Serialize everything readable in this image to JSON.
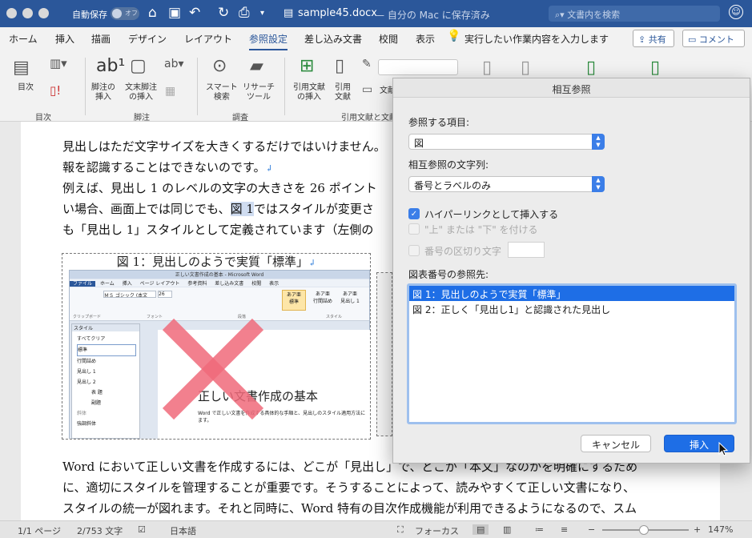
{
  "titlebar": {
    "autosave": "自動保存",
    "toggle": "オフ",
    "filename": "sample45.docx",
    "savestate": "— 自分の Mac に保存済み",
    "search": "文書内を検索"
  },
  "tabs": [
    "ホーム",
    "挿入",
    "描画",
    "デザイン",
    "レイアウト",
    "参照設定",
    "差し込み文書",
    "校閲",
    "表示"
  ],
  "tellme": "実行したい作業内容を入力します",
  "share": "共有",
  "comment": "コメント",
  "ribbon": {
    "toc": "目次",
    "footnote_insert": "脚注の\n挿入",
    "endnote_insert": "文末脚注\nの挿入",
    "smart": "スマート\n検索",
    "research": "リサーチ\nツール",
    "citation_insert": "引用文献\nの挿入",
    "citation": "引用\n文献",
    "citation_style": "文献",
    "groups": [
      "目次",
      "脚注",
      "調査",
      "引用文献と文献"
    ]
  },
  "doc": {
    "lines": [
      "見出しはただ文字サイズを大きくするだけではいけません。",
      "報を認識することはできないのです。",
      "例えば、見出し 1 のレベルの文字の大きさを 26 ポイント",
      "い場合、画面上では同じでも、",
      "図 1",
      "ではスタイルが変更さ",
      "も「見出し 1」スタイルとして定義されています（左側の"
    ],
    "fig_caption": "図 1：見出しのようで実質「標準」",
    "fig_title": "正しい文書作成の基本 - Microsoft Word",
    "fig_tabs": [
      "ファイル",
      "ホーム",
      "挿入",
      "ページ レイアウト",
      "参考資料",
      "差し込み文書",
      "校閲",
      "表示"
    ],
    "fig_font": "ＭＳ ゴシック (本文",
    "fig_size": "26",
    "fig_styles": [
      "あア亜\n標準",
      "あア亜\n行間詰め",
      "あア亜\n見出し 1"
    ],
    "fig_group_labels": [
      "クリップボード",
      "フォント",
      "段落",
      "スタイル"
    ],
    "fig_pane_title": "スタイル",
    "fig_pane_items": [
      "すべてクリア",
      "標準",
      "行間詰め",
      "見出し 1",
      "見出し 2",
      "表 題",
      "副題",
      "斜体",
      "強調斜体"
    ],
    "fig_heading": "正しい文書作成の基本",
    "fig_body": "Word で正しい文書を作成する具体的な手順と、見出しのスタイル適用方法に ます。",
    "after": [
      "Word において正しい文書を作成するには、どこが「見出し」で、どこが「本文」なのかを明確にするため",
      "に、適切にスタイルを管理することが重要です。そうすることによって、読みやすくて正しい文書になり、",
      "スタイルの統一が図れます。それと同時に、Word 特有の目次作成機能が利用できるようになるので、スム"
    ]
  },
  "status": {
    "page": "1/1 ページ",
    "words": "2/753 文字",
    "lang": "日本語",
    "focus": "フォーカス",
    "zoom": "147%"
  },
  "dialog": {
    "title": "相互参照",
    "ref_type_label": "参照する項目:",
    "ref_type": "図",
    "ref_text_label": "相互参照の文字列:",
    "ref_text": "番号とラベルのみ",
    "hyperlink": "ハイパーリンクとして挿入する",
    "above_below": "\"上\" または \"下\" を付ける",
    "separator": "番号の区切り文字",
    "list_label": "図表番号の参照先:",
    "items": [
      "図 1：見出しのようで実質「標準」",
      "図 2：正しく「見出し1」と認識された見出し"
    ],
    "cancel": "キャンセル",
    "insert": "挿入"
  }
}
